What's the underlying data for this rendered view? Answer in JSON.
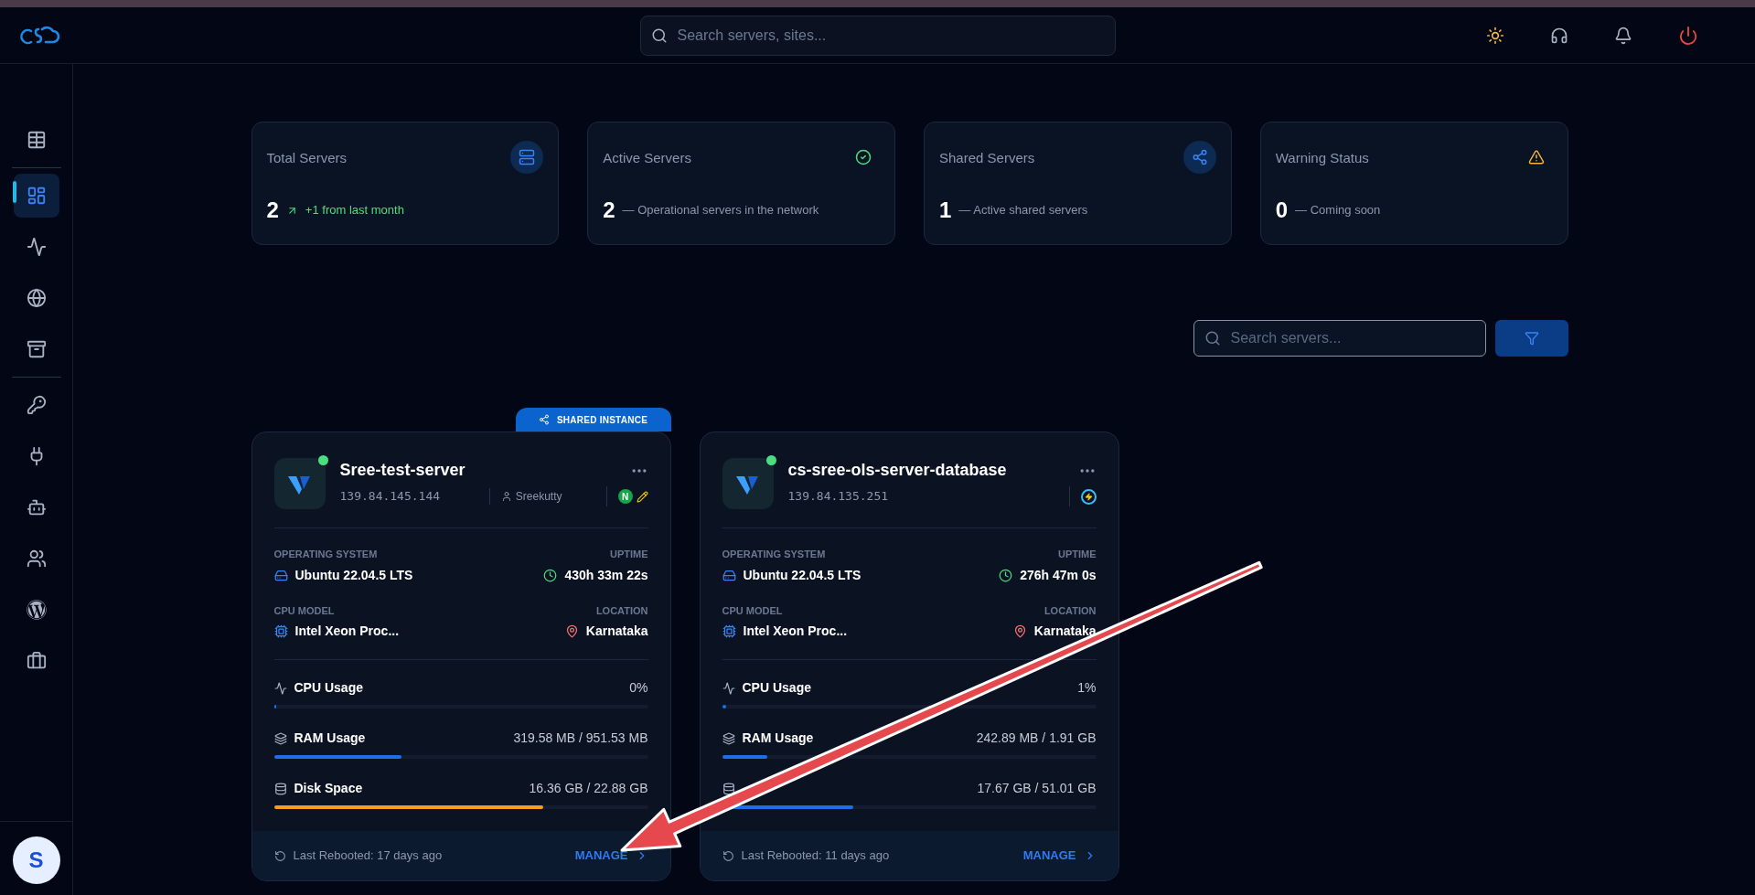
{
  "topbar": {
    "search_placeholder": "Search servers, sites..."
  },
  "sidebar": {
    "items": [
      {
        "selected": false
      },
      {
        "selected": true
      },
      {
        "selected": false
      },
      {
        "selected": false
      },
      {
        "selected": false
      },
      {
        "selected": false
      },
      {
        "selected": false
      },
      {
        "selected": false
      },
      {
        "selected": false
      },
      {
        "selected": false
      },
      {
        "selected": false
      }
    ],
    "avatar": "S"
  },
  "stats": [
    {
      "title": "Total Servers",
      "value": "2",
      "kind": "trend",
      "note": "+1 from last month"
    },
    {
      "title": "Active Servers",
      "value": "2",
      "kind": "plain",
      "note": "— Operational servers in the network"
    },
    {
      "title": "Shared Servers",
      "value": "1",
      "kind": "plain",
      "note": "— Active shared servers"
    },
    {
      "title": "Warning Status",
      "value": "0",
      "kind": "plain",
      "note": "— Coming soon"
    }
  ],
  "server_search": {
    "placeholder": "Search servers..."
  },
  "servers": [
    {
      "shared_label": "SHARED INSTANCE",
      "name": "Sree-test-server",
      "ip": "139.84.145.144",
      "user": "Sreekutty",
      "online": true,
      "badges": [
        {
          "kind": "nginx",
          "text": "N"
        },
        {
          "kind": "pencil"
        }
      ],
      "os_label": "OPERATING SYSTEM",
      "os": "Ubuntu 22.04.5 LTS",
      "uptime_label": "UPTIME",
      "uptime": "430h 33m 22s",
      "cpu_label": "CPU MODEL",
      "cpu": "Intel Xeon Proc...",
      "location_label": "LOCATION",
      "location": "Karnataka",
      "metrics": [
        {
          "kind": "cpu",
          "label": "CPU Usage",
          "reading": "0%",
          "level": 0
        },
        {
          "kind": "ram",
          "label": "RAM Usage",
          "reading": "319.58 MB / 951.53 MB",
          "level": 0.34,
          "color": "#1d6fe8"
        },
        {
          "kind": "disk",
          "label": "Disk Space",
          "reading": "16.36 GB / 22.88 GB",
          "level": 0.72,
          "color": "#f59e1b"
        }
      ],
      "rebooted": "Last Rebooted: 17 days ago",
      "manage": "MANAGE"
    },
    {
      "name": "cs-sree-ols-server-database",
      "ip": "139.84.135.251",
      "online": true,
      "badges": [
        {
          "kind": "lightning"
        }
      ],
      "os_label": "OPERATING SYSTEM",
      "os": "Ubuntu 22.04.5 LTS",
      "uptime_label": "UPTIME",
      "uptime": "276h 47m 0s",
      "cpu_label": "CPU MODEL",
      "cpu": "Intel Xeon Proc...",
      "location_label": "LOCATION",
      "location": "Karnataka",
      "metrics": [
        {
          "kind": "cpu",
          "label": "CPU Usage",
          "reading": "1%",
          "level": 0.01,
          "color": "#1d6fe8"
        },
        {
          "kind": "ram",
          "label": "RAM Usage",
          "reading": "242.89 MB / 1.91 GB",
          "level": 0.12,
          "color": "#1d6fe8"
        },
        {
          "kind": "disk",
          "reading": "17.67 GB / 51.01 GB",
          "level": 0.35,
          "color": "#1d6fe8"
        }
      ],
      "rebooted": "Last Rebooted: 11 days ago",
      "manage": "MANAGE"
    }
  ]
}
